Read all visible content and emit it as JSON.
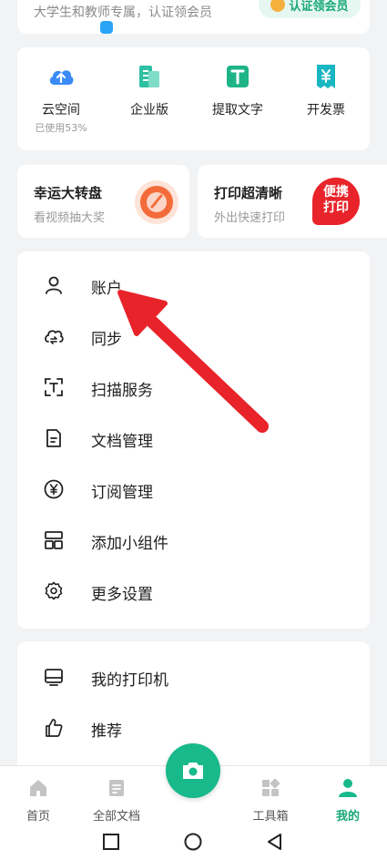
{
  "promo": {
    "subtitle": "大学生和教师专属，认证领会员",
    "button": "认证领会员"
  },
  "tools": [
    {
      "label": "云空间",
      "sub": "已使用53%",
      "icon": "cloud-upload-icon",
      "color": "#3a8bf5"
    },
    {
      "label": "企业版",
      "sub": "",
      "icon": "enterprise-icon",
      "color": "#2ec0a3"
    },
    {
      "label": "提取文字",
      "sub": "",
      "icon": "extract-text-icon",
      "color": "#1fb486"
    },
    {
      "label": "开发票",
      "sub": "",
      "icon": "invoice-icon",
      "color": "#19b7c2"
    }
  ],
  "tiles": {
    "lucky": {
      "title": "幸运大转盘",
      "sub": "看视频抽大奖"
    },
    "print": {
      "title": "打印超清晰",
      "sub": "外出快速打印",
      "badge_line1": "便携",
      "badge_line2": "打印"
    }
  },
  "menu": [
    {
      "label": "账户",
      "icon": "user-icon"
    },
    {
      "label": "同步",
      "icon": "cloud-sync-icon"
    },
    {
      "label": "扫描服务",
      "icon": "scan-text-icon"
    },
    {
      "label": "文档管理",
      "icon": "document-icon"
    },
    {
      "label": "订阅管理",
      "icon": "yen-circle-icon"
    },
    {
      "label": "添加小组件",
      "icon": "widget-icon"
    },
    {
      "label": "更多设置",
      "icon": "gear-icon"
    }
  ],
  "menu2": [
    {
      "label": "我的打印机",
      "icon": "printer-icon"
    },
    {
      "label": "推荐",
      "icon": "thumbs-up-icon"
    }
  ],
  "nav": {
    "home": "首页",
    "docs": "全部文档",
    "tools": "工具箱",
    "me": "我的"
  },
  "accent": "#18b98a",
  "annotation_color": "#e8232a"
}
